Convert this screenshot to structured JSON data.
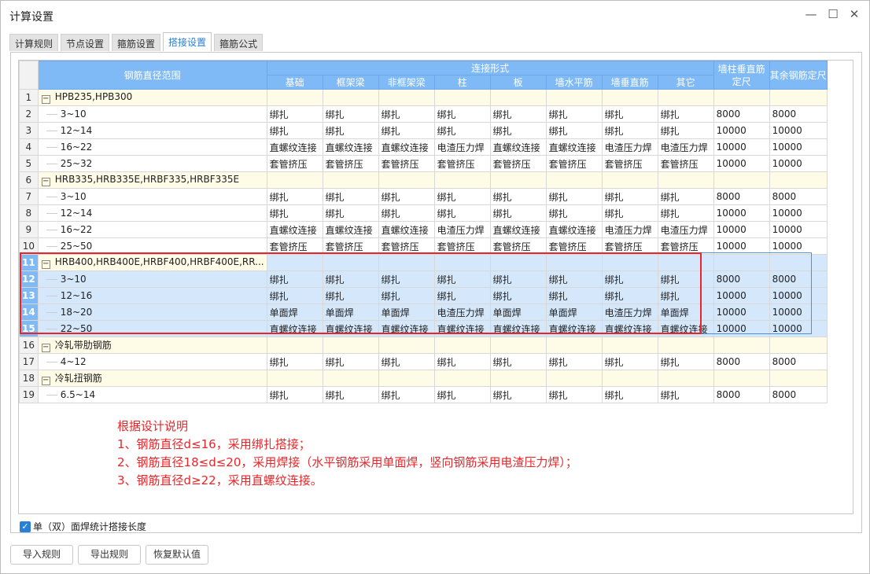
{
  "window": {
    "title": "计算设置",
    "minimize": "—",
    "maximize": "☐",
    "close": "✕"
  },
  "tabs": [
    {
      "label": "计算规则"
    },
    {
      "label": "节点设置"
    },
    {
      "label": "箍筋设置"
    },
    {
      "label": "搭接设置",
      "active": true
    },
    {
      "label": "箍筋公式"
    }
  ],
  "table": {
    "header": {
      "range": "钢筋直径范围",
      "group": "连接形式",
      "cols": [
        "基础",
        "框架梁",
        "非框架梁",
        "柱",
        "板",
        "墙水平筋",
        "墙垂直筋",
        "其它"
      ],
      "wall_len": "墙柱垂直筋定尺",
      "other_len": "其余钢筋定尺"
    },
    "rows": [
      {
        "n": "1",
        "label": "HPB235,HPB300",
        "group": true,
        "cells": []
      },
      {
        "n": "2",
        "label": "3~10",
        "cells": [
          "绑扎",
          "绑扎",
          "绑扎",
          "绑扎",
          "绑扎",
          "绑扎",
          "绑扎",
          "绑扎",
          "8000",
          "8000"
        ]
      },
      {
        "n": "3",
        "label": "12~14",
        "cells": [
          "绑扎",
          "绑扎",
          "绑扎",
          "绑扎",
          "绑扎",
          "绑扎",
          "绑扎",
          "绑扎",
          "10000",
          "10000"
        ]
      },
      {
        "n": "4",
        "label": "16~22",
        "cells": [
          "直螺纹连接",
          "直螺纹连接",
          "直螺纹连接",
          "电渣压力焊",
          "直螺纹连接",
          "直螺纹连接",
          "电渣压力焊",
          "电渣压力焊",
          "10000",
          "10000"
        ]
      },
      {
        "n": "5",
        "label": "25~32",
        "cells": [
          "套管挤压",
          "套管挤压",
          "套管挤压",
          "套管挤压",
          "套管挤压",
          "套管挤压",
          "套管挤压",
          "套管挤压",
          "10000",
          "10000"
        ]
      },
      {
        "n": "6",
        "label": "HRB335,HRB335E,HRBF335,HRBF335E",
        "group": true,
        "cells": []
      },
      {
        "n": "7",
        "label": "3~10",
        "cells": [
          "绑扎",
          "绑扎",
          "绑扎",
          "绑扎",
          "绑扎",
          "绑扎",
          "绑扎",
          "绑扎",
          "8000",
          "8000"
        ]
      },
      {
        "n": "8",
        "label": "12~14",
        "cells": [
          "绑扎",
          "绑扎",
          "绑扎",
          "绑扎",
          "绑扎",
          "绑扎",
          "绑扎",
          "绑扎",
          "10000",
          "10000"
        ]
      },
      {
        "n": "9",
        "label": "16~22",
        "cells": [
          "直螺纹连接",
          "直螺纹连接",
          "直螺纹连接",
          "电渣压力焊",
          "直螺纹连接",
          "直螺纹连接",
          "电渣压力焊",
          "电渣压力焊",
          "10000",
          "10000"
        ]
      },
      {
        "n": "10",
        "label": "25~50",
        "cells": [
          "套管挤压",
          "套管挤压",
          "套管挤压",
          "套管挤压",
          "套管挤压",
          "套管挤压",
          "套管挤压",
          "套管挤压",
          "10000",
          "10000"
        ]
      },
      {
        "n": "11",
        "label": "HRB400,HRB400E,HRBF400,HRBF400E,RR...",
        "group": true,
        "selected": true,
        "cells": []
      },
      {
        "n": "12",
        "label": "3~10",
        "selected": true,
        "cells": [
          "绑扎",
          "绑扎",
          "绑扎",
          "绑扎",
          "绑扎",
          "绑扎",
          "绑扎",
          "绑扎",
          "8000",
          "8000"
        ]
      },
      {
        "n": "13",
        "label": "12~16",
        "selected": true,
        "cells": [
          "绑扎",
          "绑扎",
          "绑扎",
          "绑扎",
          "绑扎",
          "绑扎",
          "绑扎",
          "绑扎",
          "10000",
          "10000"
        ]
      },
      {
        "n": "14",
        "label": "18~20",
        "selected": true,
        "cells": [
          "单面焊",
          "单面焊",
          "单面焊",
          "电渣压力焊",
          "单面焊",
          "单面焊",
          "电渣压力焊",
          "单面焊",
          "10000",
          "10000"
        ]
      },
      {
        "n": "15",
        "label": "22~50",
        "selected": true,
        "cells": [
          "直螺纹连接",
          "直螺纹连接",
          "直螺纹连接",
          "直螺纹连接",
          "直螺纹连接",
          "直螺纹连接",
          "直螺纹连接",
          "直螺纹连接",
          "10000",
          "10000"
        ]
      },
      {
        "n": "16",
        "label": "冷轧带肋钢筋",
        "group": true,
        "cells": []
      },
      {
        "n": "17",
        "label": "4~12",
        "cells": [
          "绑扎",
          "绑扎",
          "绑扎",
          "绑扎",
          "绑扎",
          "绑扎",
          "绑扎",
          "绑扎",
          "8000",
          "8000"
        ]
      },
      {
        "n": "18",
        "label": "冷轧扭钢筋",
        "group": true,
        "cells": []
      },
      {
        "n": "19",
        "label": "6.5~14",
        "cells": [
          "绑扎",
          "绑扎",
          "绑扎",
          "绑扎",
          "绑扎",
          "绑扎",
          "绑扎",
          "绑扎",
          "8000",
          "8000"
        ]
      }
    ]
  },
  "note": [
    "根据设计说明",
    "1、钢筋直径d≤16，采用绑扎搭接；",
    "2、钢筋直径18≤d≤20，采用焊接（水平钢筋采用单面焊，竖向钢筋采用电渣压力焊）；",
    "3、钢筋直径d≥22，采用直螺纹连接。"
  ],
  "checkbox": {
    "label": "单（双）面焊统计搭接长度",
    "checked": true,
    "mark": "✓"
  },
  "buttons": {
    "import": "导入规则",
    "export": "导出规则",
    "restore": "恢复默认值"
  },
  "colors": {
    "header": "#7fbaf7",
    "selected": "#d4e7fb",
    "group": "#fefbe6",
    "annotation": "#e8262a"
  }
}
